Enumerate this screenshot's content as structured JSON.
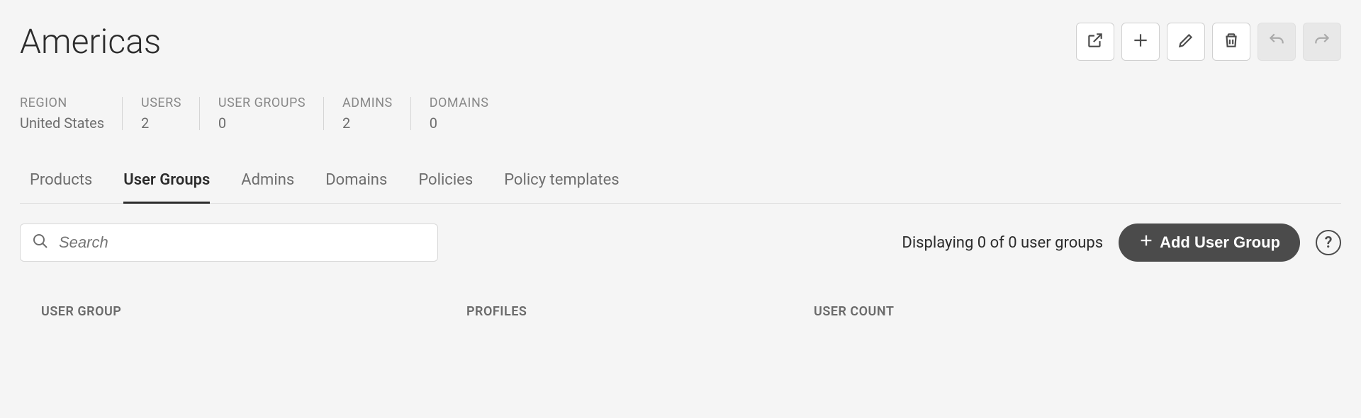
{
  "header": {
    "title": "Americas"
  },
  "stats": [
    {
      "label": "REGION",
      "value": "United States"
    },
    {
      "label": "USERS",
      "value": "2"
    },
    {
      "label": "USER GROUPS",
      "value": "0"
    },
    {
      "label": "ADMINS",
      "value": "2"
    },
    {
      "label": "DOMAINS",
      "value": "0"
    }
  ],
  "tabs": [
    {
      "label": "Products",
      "active": false
    },
    {
      "label": "User Groups",
      "active": true
    },
    {
      "label": "Admins",
      "active": false
    },
    {
      "label": "Domains",
      "active": false
    },
    {
      "label": "Policies",
      "active": false
    },
    {
      "label": "Policy templates",
      "active": false
    }
  ],
  "search": {
    "placeholder": "Search",
    "value": ""
  },
  "toolbar": {
    "display_text": "Displaying 0 of 0 user groups",
    "add_button": "Add User Group",
    "help_label": "?"
  },
  "table": {
    "columns": [
      "USER GROUP",
      "PROFILES",
      "USER COUNT"
    ],
    "rows": []
  }
}
